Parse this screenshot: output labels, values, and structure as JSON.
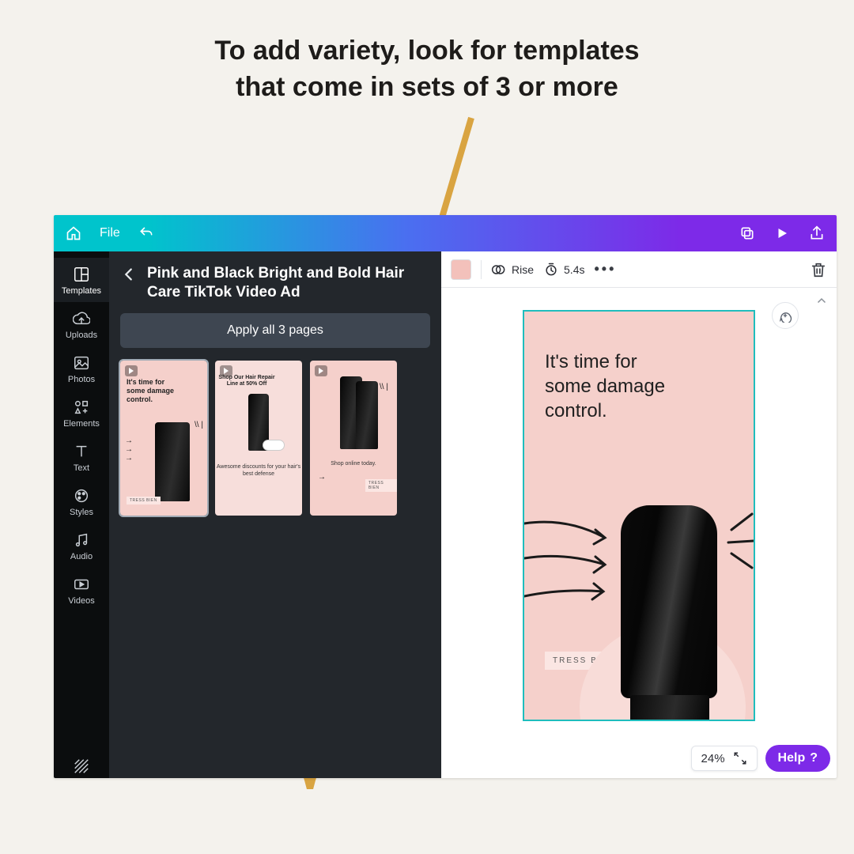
{
  "tutorial": {
    "headline_line1": "To add variety, look for templates",
    "headline_line2": "that come in sets of 3 or more"
  },
  "topbar": {
    "file_label": "File"
  },
  "rail": {
    "items": [
      {
        "label": "Templates"
      },
      {
        "label": "Uploads"
      },
      {
        "label": "Photos"
      },
      {
        "label": "Elements"
      },
      {
        "label": "Text"
      },
      {
        "label": "Styles"
      },
      {
        "label": "Audio"
      },
      {
        "label": "Videos"
      }
    ]
  },
  "panel": {
    "template_name": "Pink and Black Bright and Bold Hair Care TikTok Video Ad",
    "apply_label": "Apply all 3 pages",
    "thumbs": [
      {
        "line": "It's time for\nsome damage\ncontrol.",
        "badge": "TRESS BIEN"
      },
      {
        "line": "Shop Our Hair Repair Line at 50% Off",
        "sub": "Awesome discounts for your hair's best defense"
      },
      {
        "line": "",
        "sub": "Shop online today.",
        "badge": "TRESS BIEN"
      }
    ]
  },
  "canvas": {
    "motion_label": "Rise",
    "duration_label": "5.4s",
    "page_headline": "It's time for\nsome damage\ncontrol.",
    "page_badge": "TRESS BIEN",
    "zoom_label": "24%",
    "help_label": "Help"
  }
}
